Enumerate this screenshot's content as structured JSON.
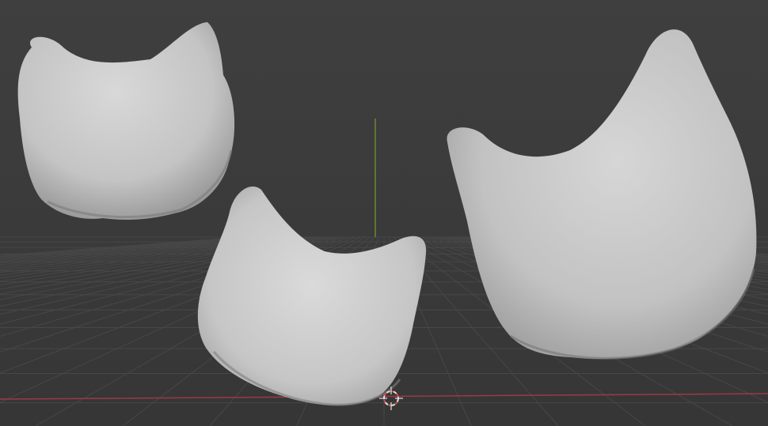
{
  "viewport": {
    "background": "#3b3b3b",
    "grid_color": "#454545",
    "x_axis_color": "#9a3a46",
    "y_axis_color": "#7a9a2e",
    "cursor_colors": [
      "#e0e0e0",
      "#d44a4a"
    ]
  },
  "objects": [
    {
      "name": "cat-head-mesh-left",
      "material_color": "#cfcfcf"
    },
    {
      "name": "cat-head-mesh-center",
      "material_color": "#cfcfcf"
    },
    {
      "name": "cat-head-mesh-right",
      "material_color": "#cfcfcf"
    }
  ],
  "icons": {
    "cursor": "3d-cursor-icon"
  }
}
